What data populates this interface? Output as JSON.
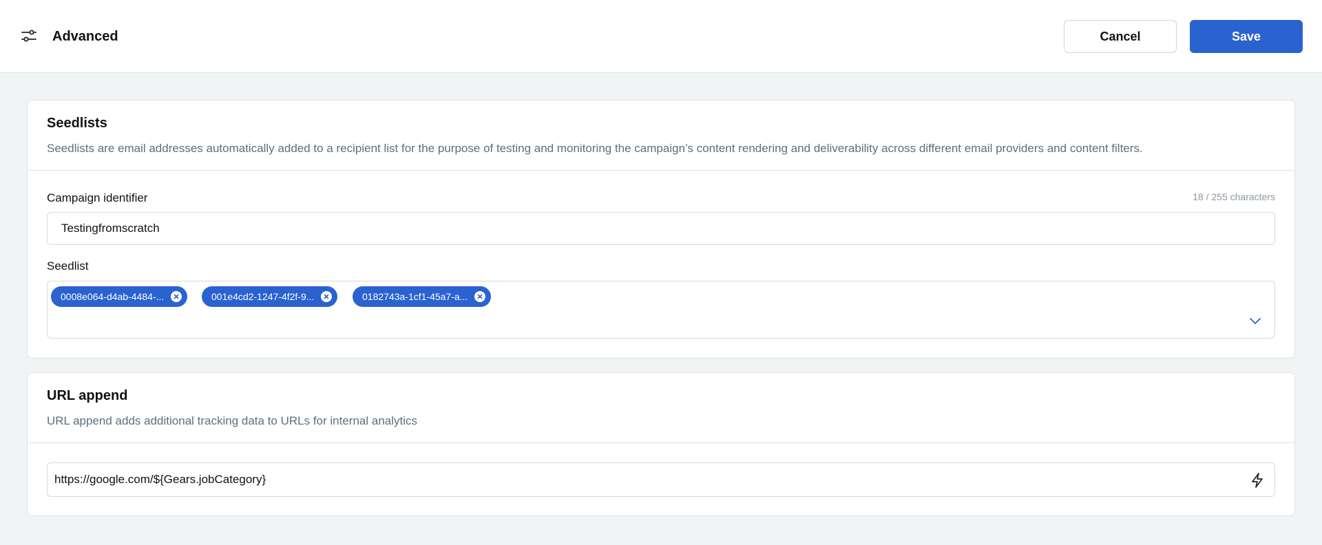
{
  "header": {
    "title": "Advanced",
    "cancel_label": "Cancel",
    "save_label": "Save",
    "icon": "sliders-icon"
  },
  "seedlists": {
    "title": "Seedlists",
    "description": "Seedlists are email addresses automatically added to a recipient list for the purpose of testing and monitoring the campaign’s content rendering and deliverability across different email providers and content filters.",
    "campaign_identifier": {
      "label": "Campaign identifier",
      "value": "Testingfromscratch",
      "char_count": "18 / 255 characters"
    },
    "seedlist": {
      "label": "Seedlist",
      "chips": [
        "0008e064-d4ab-4484-...",
        "001e4cd2-1247-4f2f-9...",
        "0182743a-1cf1-45a7-a..."
      ]
    }
  },
  "url_append": {
    "title": "URL append",
    "description": "URL append adds additional tracking data to URLs for internal analytics",
    "value": "https://google.com/${Gears.jobCategory}",
    "icon": "lightning-icon"
  },
  "colors": {
    "primary": "#2a62d0",
    "muted_text": "#5b6f82",
    "background": "#f1f4f4"
  }
}
